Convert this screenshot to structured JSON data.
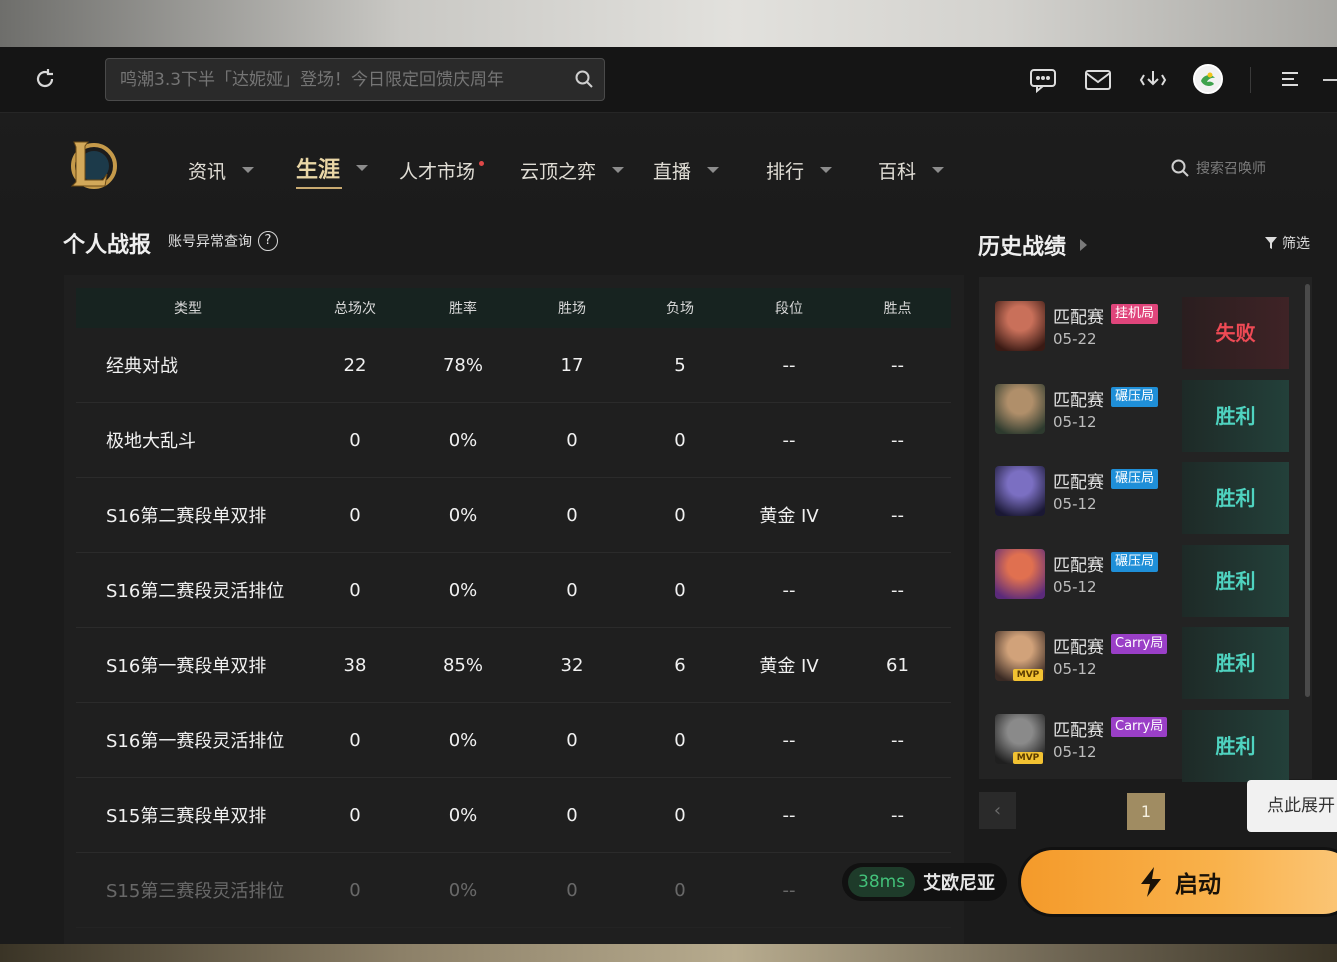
{
  "topbar": {
    "search_placeholder": "鸣潮3.3下半「达妮娅」登场！今日限定回馈庆周年"
  },
  "nav": {
    "items": [
      {
        "label": "资讯",
        "caret": true
      },
      {
        "label": "生涯",
        "caret": true,
        "active": true
      },
      {
        "label": "人才市场",
        "dot": true
      },
      {
        "label": "云顶之弈",
        "caret": true
      },
      {
        "label": "直播",
        "caret": true
      },
      {
        "label": "排行",
        "caret": true
      },
      {
        "label": "百科",
        "caret": true
      }
    ],
    "search_label": "搜索召唤师"
  },
  "stats": {
    "title": "个人战报",
    "account_check": "账号异常查询",
    "help": "?",
    "headers": [
      "类型",
      "总场次",
      "胜率",
      "胜场",
      "负场",
      "段位",
      "胜点"
    ],
    "rows": [
      [
        "经典对战",
        "22",
        "78%",
        "17",
        "5",
        "--",
        "--"
      ],
      [
        "极地大乱斗",
        "0",
        "0%",
        "0",
        "0",
        "--",
        "--"
      ],
      [
        "S16第二赛段单双排",
        "0",
        "0%",
        "0",
        "0",
        "黄金 IV",
        "--"
      ],
      [
        "S16第二赛段灵活排位",
        "0",
        "0%",
        "0",
        "0",
        "--",
        "--"
      ],
      [
        "S16第一赛段单双排",
        "38",
        "85%",
        "32",
        "6",
        "黄金 IV",
        "61"
      ],
      [
        "S16第一赛段灵活排位",
        "0",
        "0%",
        "0",
        "0",
        "--",
        "--"
      ],
      [
        "S15第三赛段单双排",
        "0",
        "0%",
        "0",
        "0",
        "--",
        "--"
      ],
      [
        "S15第三赛段灵活排位",
        "0",
        "0%",
        "0",
        "0",
        "--",
        "--"
      ]
    ]
  },
  "history": {
    "title": "历史战绩",
    "filter": "筛选",
    "matches": [
      {
        "mode": "匹配赛",
        "tag": "挂机局",
        "tag_color": "#e0457b",
        "date": "05-22",
        "result": "失败",
        "win": false,
        "mvp": false,
        "c1": "#c9705a",
        "c2": "#3a1a14"
      },
      {
        "mode": "匹配赛",
        "tag": "碾压局",
        "tag_color": "#1f8fd8",
        "date": "05-12",
        "result": "胜利",
        "win": true,
        "mvp": false,
        "c1": "#b08f6a",
        "c2": "#2d3a2e"
      },
      {
        "mode": "匹配赛",
        "tag": "碾压局",
        "tag_color": "#1f8fd8",
        "date": "05-12",
        "result": "胜利",
        "win": true,
        "mvp": false,
        "c1": "#7b6fc2",
        "c2": "#1a1834"
      },
      {
        "mode": "匹配赛",
        "tag": "碾压局",
        "tag_color": "#1f8fd8",
        "date": "05-12",
        "result": "胜利",
        "win": true,
        "mvp": false,
        "c1": "#e07050",
        "c2": "#5b2a7a"
      },
      {
        "mode": "匹配赛",
        "tag": "Carry局",
        "tag_color": "#9a3fc7",
        "date": "05-12",
        "result": "胜利",
        "win": true,
        "mvp": true,
        "mvp_label": "MVP",
        "c1": "#d1a27a",
        "c2": "#3a2a24"
      },
      {
        "mode": "匹配赛",
        "tag": "Carry局",
        "tag_color": "#9a3fc7",
        "date": "05-12",
        "result": "胜利",
        "win": true,
        "mvp": true,
        "mvp_label": "MVP",
        "c1": "#8a8a8a",
        "c2": "#1f1f1f"
      }
    ],
    "pager": {
      "prev": "‹",
      "current": "1"
    },
    "expand_tip": "点此展开"
  },
  "launch": {
    "ping": "38ms",
    "server": "艾欧尼亚",
    "button": "启动"
  },
  "colors": {
    "accent": "#c9aa71",
    "win": "#4fd3c0",
    "lose": "#ee4a55",
    "launch": "#f49a2a"
  },
  "icons": [
    "refresh-icon",
    "search-icon",
    "chat-icon",
    "mail-icon",
    "download-icon",
    "avatar",
    "menu-icon",
    "minimize-icon",
    "filter-icon",
    "lightning-icon",
    "question-icon"
  ]
}
